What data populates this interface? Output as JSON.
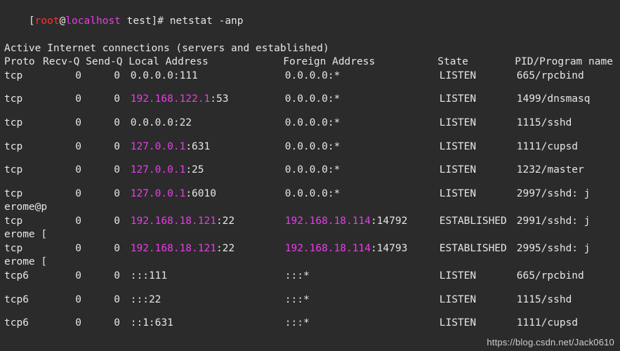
{
  "prompt": {
    "user": "root",
    "host": "localhost",
    "cwd": "test",
    "command": "netstat",
    "flags": "-anp"
  },
  "title_line": "Active Internet connections (servers and established)",
  "header": {
    "proto": "Proto",
    "recvq": "Recv-Q",
    "sendq": "Send-Q",
    "local": "Local Address",
    "foreign": "Foreign Address",
    "state": "State",
    "pid": "PID/Program name"
  },
  "rows": [
    {
      "proto": "tcp",
      "rq": "0",
      "sq": "0",
      "loc_ip": "0.0.0.0",
      "loc_port": "111",
      "loc_colored": false,
      "for_ip": "0.0.0.0",
      "for_port": "*",
      "for_colored": false,
      "state": "LISTEN",
      "pid": "665/rpcbind",
      "wrap": ""
    },
    {
      "proto": "tcp",
      "rq": "0",
      "sq": "0",
      "loc_ip": "192.168.122.1",
      "loc_port": "53",
      "loc_colored": true,
      "for_ip": "0.0.0.0",
      "for_port": "*",
      "for_colored": false,
      "state": "LISTEN",
      "pid": "1499/dnsmasq",
      "wrap": ""
    },
    {
      "proto": "tcp",
      "rq": "0",
      "sq": "0",
      "loc_ip": "0.0.0.0",
      "loc_port": "22",
      "loc_colored": false,
      "for_ip": "0.0.0.0",
      "for_port": "*",
      "for_colored": false,
      "state": "LISTEN",
      "pid": "1115/sshd",
      "wrap": ""
    },
    {
      "proto": "tcp",
      "rq": "0",
      "sq": "0",
      "loc_ip": "127.0.0.1",
      "loc_port": "631",
      "loc_colored": true,
      "for_ip": "0.0.0.0",
      "for_port": "*",
      "for_colored": false,
      "state": "LISTEN",
      "pid": "1111/cupsd",
      "wrap": ""
    },
    {
      "proto": "tcp",
      "rq": "0",
      "sq": "0",
      "loc_ip": "127.0.0.1",
      "loc_port": "25",
      "loc_colored": true,
      "for_ip": "0.0.0.0",
      "for_port": "*",
      "for_colored": false,
      "state": "LISTEN",
      "pid": "1232/master",
      "wrap": ""
    },
    {
      "proto": "tcp",
      "rq": "0",
      "sq": "0",
      "loc_ip": "127.0.0.1",
      "loc_port": "6010",
      "loc_colored": true,
      "for_ip": "0.0.0.0",
      "for_port": "*",
      "for_colored": false,
      "state": "LISTEN",
      "pid": "2997/sshd: j",
      "wrap": "erome@p"
    },
    {
      "proto": "tcp",
      "rq": "0",
      "sq": "0",
      "loc_ip": "192.168.18.121",
      "loc_port": "22",
      "loc_colored": true,
      "for_ip": "192.168.18.114",
      "for_port": "14792",
      "for_colored": true,
      "state": "ESTABLISHED",
      "pid": "2991/sshd: j",
      "wrap": "erome ["
    },
    {
      "proto": "tcp",
      "rq": "0",
      "sq": "0",
      "loc_ip": "192.168.18.121",
      "loc_port": "22",
      "loc_colored": true,
      "for_ip": "192.168.18.114",
      "for_port": "14793",
      "for_colored": true,
      "state": "ESTABLISHED",
      "pid": "2995/sshd: j",
      "wrap": "erome ["
    },
    {
      "proto": "tcp6",
      "rq": "0",
      "sq": "0",
      "loc_ip": ":::",
      "loc_port": "111",
      "loc_colored": false,
      "for_ip": ":::",
      "for_port": "*",
      "for_colored": false,
      "state": "LISTEN",
      "pid": "665/rpcbind",
      "wrap": ""
    },
    {
      "proto": "tcp6",
      "rq": "0",
      "sq": "0",
      "loc_ip": ":::",
      "loc_port": "22",
      "loc_colored": false,
      "for_ip": ":::",
      "for_port": "*",
      "for_colored": false,
      "state": "LISTEN",
      "pid": "1115/sshd",
      "wrap": ""
    },
    {
      "proto": "tcp6",
      "rq": "0",
      "sq": "0",
      "loc_ip": "::1:",
      "loc_port": "631",
      "loc_colored": false,
      "for_ip": ":::",
      "for_port": "*",
      "for_colored": false,
      "state": "LISTEN",
      "pid": "1111/cupsd",
      "wrap": ""
    }
  ],
  "watermark": "https://blog.csdn.net/Jack0610"
}
